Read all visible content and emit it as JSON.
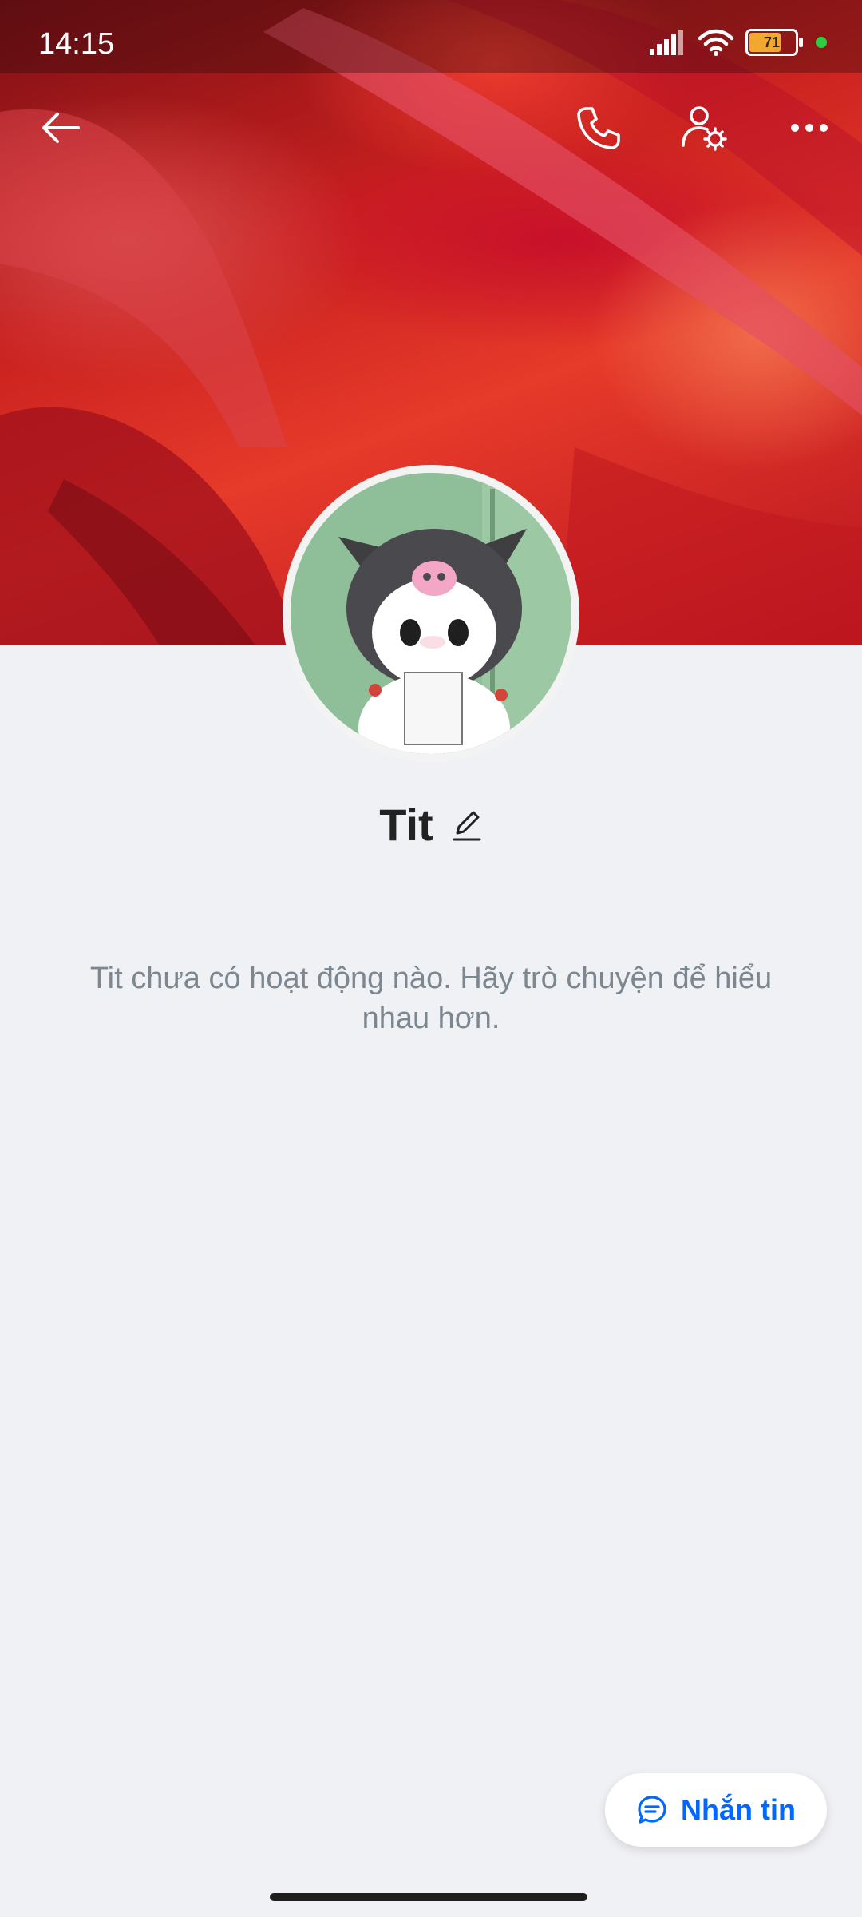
{
  "status_bar": {
    "time": "14:15",
    "battery": "71",
    "battery_fraction": 0.71
  },
  "top_bar": {
    "back_icon": "arrow-left-icon",
    "call_icon": "phone-icon",
    "profile_settings_icon": "user-gear-icon",
    "more_icon": "more-dots-icon"
  },
  "profile": {
    "name": "Tit",
    "edit_icon": "pencil-icon",
    "empty_message": "Tit chưa có hoạt động nào. Hãy trò chuyện để hiểu nhau hơn."
  },
  "actions": {
    "message_label": "Nhắn tin",
    "message_icon": "chat-bubble-icon"
  },
  "colors": {
    "accent": "#0068ff",
    "background": "#f0f1f5"
  }
}
